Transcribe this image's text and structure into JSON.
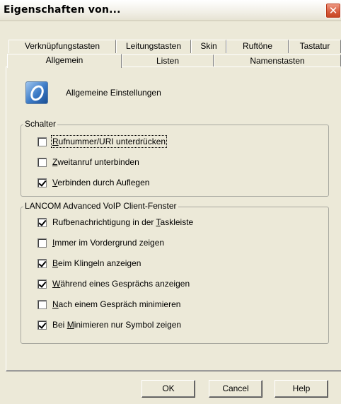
{
  "window": {
    "title": "Eigenschaften von...",
    "close_glyph": "✕"
  },
  "tabs": {
    "row1": [
      "Verknüpfungstasten",
      "Leitungstasten",
      "Skin",
      "Ruftöne",
      "Tastatur"
    ],
    "row2": [
      "Allgemein",
      "Listen",
      "Namenstasten"
    ],
    "selected": "Allgemein"
  },
  "header": {
    "icon": "voip-client-icon",
    "label": "Allgemeine Einstellungen"
  },
  "schalter": {
    "title": "Schalter",
    "items": [
      {
        "pre": "",
        "key": "R",
        "post": "ufnummer/URI unterdrücken",
        "checked": false
      },
      {
        "pre": "",
        "key": "Z",
        "post": "weitanruf unterbinden",
        "checked": false
      },
      {
        "pre": "",
        "key": "V",
        "post": "erbinden durch Auflegen",
        "checked": true
      }
    ]
  },
  "client_fenster": {
    "title": "LANCOM Advanced VoIP Client-Fenster",
    "items": [
      {
        "pre": "Rufbenachrichtigung in der ",
        "key": "T",
        "post": "askleiste",
        "checked": true
      },
      {
        "pre": "",
        "key": "I",
        "post": "mmer im Vordergrund zeigen",
        "checked": false
      },
      {
        "pre": "",
        "key": "B",
        "post": "eim Klingeln anzeigen",
        "checked": true
      },
      {
        "pre": "",
        "key": "W",
        "post": "ährend eines Gesprächs anzeigen",
        "checked": true
      },
      {
        "pre": "",
        "key": "N",
        "post": "ach einem Gespräch minimieren",
        "checked": false
      },
      {
        "pre": "Bei ",
        "key": "M",
        "post": "inimieren nur Symbol zeigen",
        "checked": true
      }
    ]
  },
  "buttons": {
    "ok": "OK",
    "cancel": "Cancel",
    "help": "Help"
  }
}
